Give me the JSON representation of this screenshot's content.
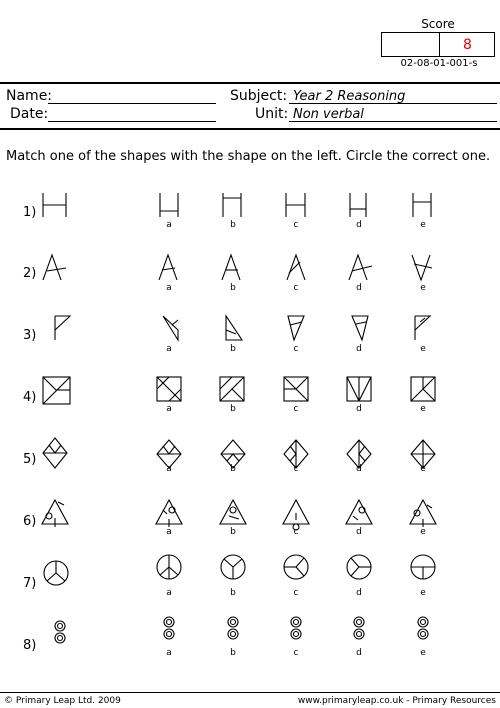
{
  "score": {
    "label": "Score",
    "value": "8",
    "code": "02-08-01-001-s"
  },
  "header": {
    "name_label": "Name:",
    "date_label": "Date:",
    "subject_label": "Subject:",
    "subject_value": "Year 2 Reasoning",
    "unit_label": "Unit:",
    "unit_value": "Non verbal"
  },
  "instruction": "Match one of the shapes with the shape on the left. Circle the correct one.",
  "option_letters": [
    "a",
    "b",
    "c",
    "d",
    "e"
  ],
  "questions": [
    {
      "number": "1)",
      "shape": "H"
    },
    {
      "number": "2)",
      "shape": "inverted-V with crossbar"
    },
    {
      "number": "3)",
      "shape": "flag triangle"
    },
    {
      "number": "4)",
      "shape": "square with diagonals"
    },
    {
      "number": "5)",
      "shape": "diamond"
    },
    {
      "number": "6)",
      "shape": "triangle with circle"
    },
    {
      "number": "7)",
      "shape": "circle with lines"
    },
    {
      "number": "8)",
      "shape": "two stacked circles"
    }
  ],
  "footer": {
    "left": "© Primary Leap Ltd. 2009",
    "right": "www.primaryleap.co.uk  -  Primary Resources"
  }
}
